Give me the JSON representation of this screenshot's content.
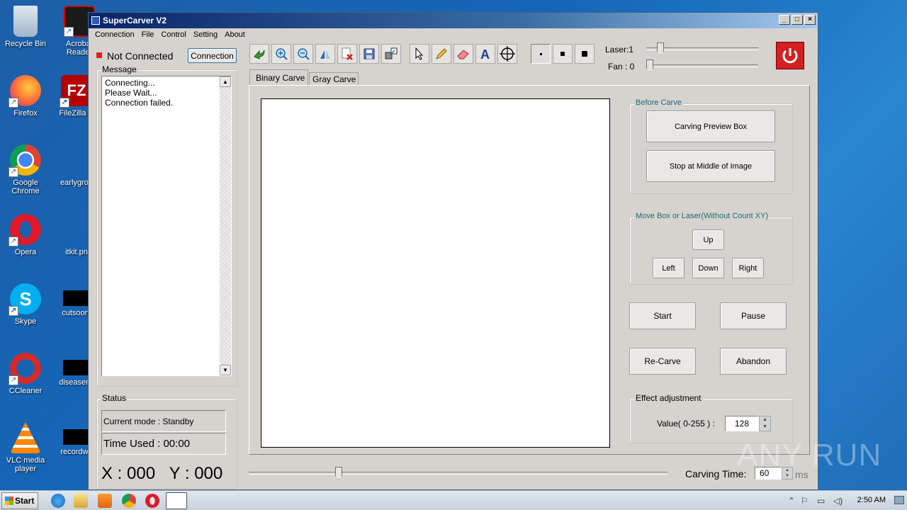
{
  "desktop": {
    "icons": [
      {
        "label": "Recycle Bin"
      },
      {
        "label": "Acrobat Reader"
      },
      {
        "label": "Firefox"
      },
      {
        "label": "FileZilla C"
      },
      {
        "label": "Google Chrome"
      },
      {
        "label": "earlygrou"
      },
      {
        "label": "Opera"
      },
      {
        "label": "itkit.pn"
      },
      {
        "label": "Skype"
      },
      {
        "label": "cutsoon."
      },
      {
        "label": "CCleaner"
      },
      {
        "label": "diseasemi"
      },
      {
        "label": "VLC media player"
      },
      {
        "label": "recordwa"
      }
    ]
  },
  "window": {
    "title": "SuperCarver V2",
    "minimize": "_",
    "maximize": "□",
    "close": "×"
  },
  "menu": [
    "Connection",
    "File",
    "Control",
    "Setting",
    "About"
  ],
  "connection": {
    "status": "Not Connected",
    "button": "Connection"
  },
  "message": {
    "title": "Message",
    "lines": [
      "Connecting...",
      "Please Wait...",
      "Connection failed."
    ]
  },
  "status": {
    "title": "Status",
    "mode": "Current mode : Standby",
    "time_used": "Time Used :  00:00",
    "xy": "X : 000   Y : 000"
  },
  "toolbar": {
    "laser_label": "Laser:1",
    "fan_label": "Fan : 0",
    "laser_value": 1,
    "fan_value": 0
  },
  "tabs": [
    "Binary Carve",
    "Gray Carve"
  ],
  "before_carve": {
    "title": "Before Carve",
    "preview": "Carving Preview Box",
    "stop_middle": "Stop at Middle of Image"
  },
  "move_box": {
    "title": "Move Box or Laser(Without Count XY)",
    "up": "Up",
    "left": "Left",
    "down": "Down",
    "right": "Right"
  },
  "actions": {
    "start": "Start",
    "pause": "Pause",
    "recarve": "Re-Carve",
    "abandon": "Abandon"
  },
  "effect": {
    "title": "Effect adjustment",
    "label": "Value( 0-255 ) :",
    "value": "128"
  },
  "carving_time": {
    "label": "Carving Time:",
    "value": "60",
    "unit": "ms"
  },
  "taskbar": {
    "start": "Start",
    "clock": "2:50 AM"
  },
  "watermark": "ANY RUN",
  "colors": {
    "power_red": "#d42020",
    "status_dot": "#e02020",
    "group_title": "#1f6a7a"
  }
}
